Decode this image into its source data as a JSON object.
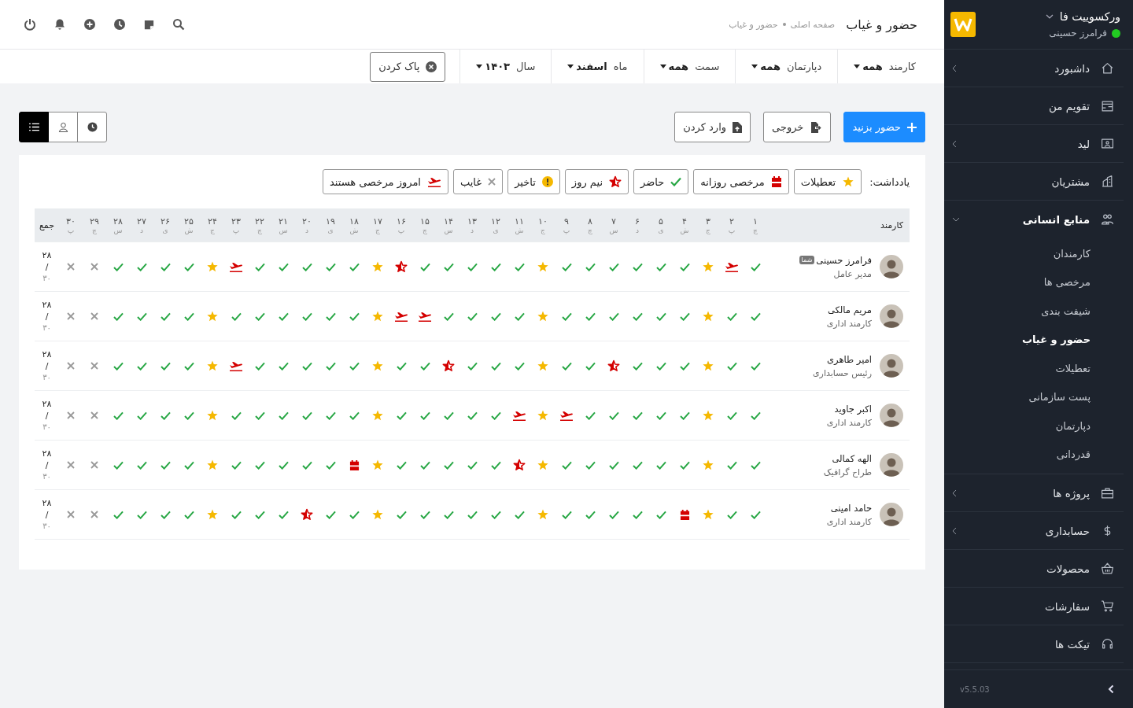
{
  "sidebar": {
    "brand": "ورکسوییت فا",
    "user": {
      "name": "فرامرز حسینی",
      "online": true
    },
    "items": [
      {
        "label": "داشبورد",
        "submenu": true,
        "expanded": false
      },
      {
        "label": "تقویم من",
        "submenu": false
      },
      {
        "label": "لید",
        "submenu": true,
        "expanded": false
      },
      {
        "label": "مشتریان",
        "submenu": false
      },
      {
        "label": "منابع انسانی",
        "submenu": true,
        "expanded": true,
        "children": [
          {
            "label": "کارمندان",
            "selected": false
          },
          {
            "label": "مرخصی ها",
            "selected": false
          },
          {
            "label": "شیفت بندی",
            "selected": false
          },
          {
            "label": "حضور و غیاب",
            "selected": true
          },
          {
            "label": "تعطیلات",
            "selected": false
          },
          {
            "label": "پست سازمانی",
            "selected": false
          },
          {
            "label": "دپارتمان",
            "selected": false
          },
          {
            "label": "قدردانی",
            "selected": false
          }
        ]
      },
      {
        "label": "پروژه ها",
        "submenu": true,
        "expanded": false
      },
      {
        "label": "حسابداری",
        "submenu": true,
        "expanded": false
      },
      {
        "label": "محصولات",
        "submenu": false
      },
      {
        "label": "سفارشات",
        "submenu": false
      },
      {
        "label": "تیکت ها",
        "submenu": false
      }
    ],
    "version": "v5.5.03"
  },
  "header": {
    "title": "حضور و غیاب",
    "breadcrumb": [
      "صفحه اصلی",
      "حضور و غیاب"
    ]
  },
  "filters": [
    {
      "label": "کارمند",
      "value": "همه"
    },
    {
      "label": "دپارتمان",
      "value": "همه"
    },
    {
      "label": "سمت",
      "value": "همه"
    },
    {
      "label": "ماه",
      "value": "اسفند"
    },
    {
      "label": "سال",
      "value": "۱۴۰۳"
    }
  ],
  "clear_button": "پاک کردن",
  "actions": [
    {
      "label": "حضور بزنید",
      "kind": "primary"
    },
    {
      "label": "خروجی",
      "kind": "export"
    },
    {
      "label": "وارد کردن",
      "kind": "import"
    }
  ],
  "view_toggle": [
    {
      "selected": false
    },
    {
      "selected": false
    },
    {
      "selected": true
    }
  ],
  "legend": {
    "label": "یادداشت:",
    "items": [
      {
        "kind": "holiday",
        "label": "تعطیلات"
      },
      {
        "kind": "daily",
        "label": "مرخصی روزانه"
      },
      {
        "kind": "present",
        "label": "حاضر"
      },
      {
        "kind": "half",
        "label": "نیم روز"
      },
      {
        "kind": "late",
        "label": "تاخیر"
      },
      {
        "kind": "absent",
        "label": "غایب"
      },
      {
        "kind": "leave",
        "label": "امروز مرخصی هستند"
      }
    ]
  },
  "table": {
    "employee_header": "کارمند",
    "total_header": "جمع",
    "days": [
      {
        "day": "۱",
        "weekday": "چ"
      },
      {
        "day": "۲",
        "weekday": "پ"
      },
      {
        "day": "۳",
        "weekday": "ج"
      },
      {
        "day": "۴",
        "weekday": "ش"
      },
      {
        "day": "۵",
        "weekday": "ی"
      },
      {
        "day": "۶",
        "weekday": "د"
      },
      {
        "day": "۷",
        "weekday": "س"
      },
      {
        "day": "۸",
        "weekday": "چ"
      },
      {
        "day": "۹",
        "weekday": "پ"
      },
      {
        "day": "۱۰",
        "weekday": "ج"
      },
      {
        "day": "۱۱",
        "weekday": "ش"
      },
      {
        "day": "۱۲",
        "weekday": "ی"
      },
      {
        "day": "۱۳",
        "weekday": "د"
      },
      {
        "day": "۱۴",
        "weekday": "س"
      },
      {
        "day": "۱۵",
        "weekday": "چ"
      },
      {
        "day": "۱۶",
        "weekday": "پ"
      },
      {
        "day": "۱۷",
        "weekday": "ج"
      },
      {
        "day": "۱۸",
        "weekday": "ش"
      },
      {
        "day": "۱۹",
        "weekday": "ی"
      },
      {
        "day": "۲۰",
        "weekday": "د"
      },
      {
        "day": "۲۱",
        "weekday": "س"
      },
      {
        "day": "۲۲",
        "weekday": "چ"
      },
      {
        "day": "۲۳",
        "weekday": "پ"
      },
      {
        "day": "۲۴",
        "weekday": "ج"
      },
      {
        "day": "۲۵",
        "weekday": "ش"
      },
      {
        "day": "۲۶",
        "weekday": "ی"
      },
      {
        "day": "۲۷",
        "weekday": "د"
      },
      {
        "day": "۲۸",
        "weekday": "س"
      },
      {
        "day": "۲۹",
        "weekday": "چ"
      },
      {
        "day": "۳۰",
        "weekday": "پ"
      }
    ],
    "rows": [
      {
        "name": "فرامرز حسینی",
        "badge": "شما",
        "role": "مدیر عامل",
        "total": {
          "present": "۲۸",
          "separator": "/",
          "days": "۳۰"
        },
        "days": [
          {
            "kind": "present"
          },
          {
            "kind": "leave"
          },
          {
            "kind": "holiday"
          },
          {
            "kind": "present"
          },
          {
            "kind": "present"
          },
          {
            "kind": "present"
          },
          {
            "kind": "present"
          },
          {
            "kind": "present"
          },
          {
            "kind": "present"
          },
          {
            "kind": "holiday"
          },
          {
            "kind": "present"
          },
          {
            "kind": "present"
          },
          {
            "kind": "present"
          },
          {
            "kind": "present"
          },
          {
            "kind": "present"
          },
          {
            "kind": "half"
          },
          {
            "kind": "holiday"
          },
          {
            "kind": "present"
          },
          {
            "kind": "present"
          },
          {
            "kind": "present"
          },
          {
            "kind": "present"
          },
          {
            "kind": "present"
          },
          {
            "kind": "leave"
          },
          {
            "kind": "holiday"
          },
          {
            "kind": "present"
          },
          {
            "kind": "present"
          },
          {
            "kind": "present"
          },
          {
            "kind": "present"
          },
          {
            "kind": "absent"
          },
          {
            "kind": "absent"
          }
        ]
      },
      {
        "name": "مریم مالکی",
        "role": "کارمند اداری",
        "total": {
          "present": "۲۸",
          "separator": "/",
          "days": "۳۰"
        },
        "days": [
          {
            "kind": "present"
          },
          {
            "kind": "present"
          },
          {
            "kind": "holiday"
          },
          {
            "kind": "present"
          },
          {
            "kind": "present"
          },
          {
            "kind": "present"
          },
          {
            "kind": "present"
          },
          {
            "kind": "present"
          },
          {
            "kind": "present"
          },
          {
            "kind": "holiday"
          },
          {
            "kind": "present"
          },
          {
            "kind": "present"
          },
          {
            "kind": "present"
          },
          {
            "kind": "present"
          },
          {
            "kind": "leave"
          },
          {
            "kind": "leave"
          },
          {
            "kind": "holiday"
          },
          {
            "kind": "present"
          },
          {
            "kind": "present"
          },
          {
            "kind": "present"
          },
          {
            "kind": "present"
          },
          {
            "kind": "present"
          },
          {
            "kind": "present"
          },
          {
            "kind": "holiday"
          },
          {
            "kind": "present"
          },
          {
            "kind": "present"
          },
          {
            "kind": "present"
          },
          {
            "kind": "present"
          },
          {
            "kind": "absent"
          },
          {
            "kind": "absent"
          }
        ]
      },
      {
        "name": "امیر طاهری",
        "role": "رئیس حسابداری",
        "total": {
          "present": "۲۸",
          "separator": "/",
          "days": "۳۰"
        },
        "days": [
          {
            "kind": "present"
          },
          {
            "kind": "present"
          },
          {
            "kind": "holiday"
          },
          {
            "kind": "present"
          },
          {
            "kind": "present"
          },
          {
            "kind": "present"
          },
          {
            "kind": "half"
          },
          {
            "kind": "present"
          },
          {
            "kind": "present"
          },
          {
            "kind": "holiday"
          },
          {
            "kind": "present"
          },
          {
            "kind": "present"
          },
          {
            "kind": "present"
          },
          {
            "kind": "half"
          },
          {
            "kind": "present"
          },
          {
            "kind": "present"
          },
          {
            "kind": "holiday"
          },
          {
            "kind": "present"
          },
          {
            "kind": "present"
          },
          {
            "kind": "present"
          },
          {
            "kind": "present"
          },
          {
            "kind": "present"
          },
          {
            "kind": "leave"
          },
          {
            "kind": "holiday"
          },
          {
            "kind": "present"
          },
          {
            "kind": "present"
          },
          {
            "kind": "present"
          },
          {
            "kind": "present"
          },
          {
            "kind": "absent"
          },
          {
            "kind": "absent"
          }
        ]
      },
      {
        "name": "اکبر جاوید",
        "role": "کارمند اداری",
        "total": {
          "present": "۲۸",
          "separator": "/",
          "days": "۳۰"
        },
        "days": [
          {
            "kind": "present"
          },
          {
            "kind": "present"
          },
          {
            "kind": "holiday"
          },
          {
            "kind": "present"
          },
          {
            "kind": "present"
          },
          {
            "kind": "present"
          },
          {
            "kind": "present"
          },
          {
            "kind": "present"
          },
          {
            "kind": "leave"
          },
          {
            "kind": "holiday"
          },
          {
            "kind": "leave"
          },
          {
            "kind": "present"
          },
          {
            "kind": "present"
          },
          {
            "kind": "present"
          },
          {
            "kind": "present"
          },
          {
            "kind": "present"
          },
          {
            "kind": "holiday"
          },
          {
            "kind": "present"
          },
          {
            "kind": "present"
          },
          {
            "kind": "present"
          },
          {
            "kind": "present"
          },
          {
            "kind": "present"
          },
          {
            "kind": "present"
          },
          {
            "kind": "holiday"
          },
          {
            "kind": "present"
          },
          {
            "kind": "present"
          },
          {
            "kind": "present"
          },
          {
            "kind": "present"
          },
          {
            "kind": "absent"
          },
          {
            "kind": "absent"
          }
        ]
      },
      {
        "name": "الهه کمالی",
        "role": "طراح گرافیک",
        "total": {
          "present": "۲۸",
          "separator": "/",
          "days": "۳۰"
        },
        "days": [
          {
            "kind": "present"
          },
          {
            "kind": "present"
          },
          {
            "kind": "holiday"
          },
          {
            "kind": "present"
          },
          {
            "kind": "present"
          },
          {
            "kind": "present"
          },
          {
            "kind": "present"
          },
          {
            "kind": "present"
          },
          {
            "kind": "present"
          },
          {
            "kind": "holiday"
          },
          {
            "kind": "half"
          },
          {
            "kind": "present"
          },
          {
            "kind": "present"
          },
          {
            "kind": "present"
          },
          {
            "kind": "present"
          },
          {
            "kind": "present"
          },
          {
            "kind": "holiday"
          },
          {
            "kind": "daily"
          },
          {
            "kind": "present"
          },
          {
            "kind": "present"
          },
          {
            "kind": "present"
          },
          {
            "kind": "present"
          },
          {
            "kind": "present"
          },
          {
            "kind": "holiday"
          },
          {
            "kind": "present"
          },
          {
            "kind": "present"
          },
          {
            "kind": "present"
          },
          {
            "kind": "present"
          },
          {
            "kind": "absent"
          },
          {
            "kind": "absent"
          }
        ]
      },
      {
        "name": "حامد امینی",
        "role": "کارمند اداری",
        "total": {
          "present": "۲۸",
          "separator": "/",
          "days": "۳۰"
        },
        "days": [
          {
            "kind": "present"
          },
          {
            "kind": "present"
          },
          {
            "kind": "holiday"
          },
          {
            "kind": "daily"
          },
          {
            "kind": "present"
          },
          {
            "kind": "present"
          },
          {
            "kind": "present"
          },
          {
            "kind": "present"
          },
          {
            "kind": "present"
          },
          {
            "kind": "holiday"
          },
          {
            "kind": "present"
          },
          {
            "kind": "present"
          },
          {
            "kind": "present"
          },
          {
            "kind": "present"
          },
          {
            "kind": "present"
          },
          {
            "kind": "present"
          },
          {
            "kind": "holiday"
          },
          {
            "kind": "present"
          },
          {
            "kind": "present"
          },
          {
            "kind": "half"
          },
          {
            "kind": "present"
          },
          {
            "kind": "present"
          },
          {
            "kind": "present"
          },
          {
            "kind": "holiday"
          },
          {
            "kind": "present"
          },
          {
            "kind": "present"
          },
          {
            "kind": "present"
          },
          {
            "kind": "present"
          },
          {
            "kind": "absent"
          },
          {
            "kind": "absent"
          }
        ]
      }
    ]
  }
}
